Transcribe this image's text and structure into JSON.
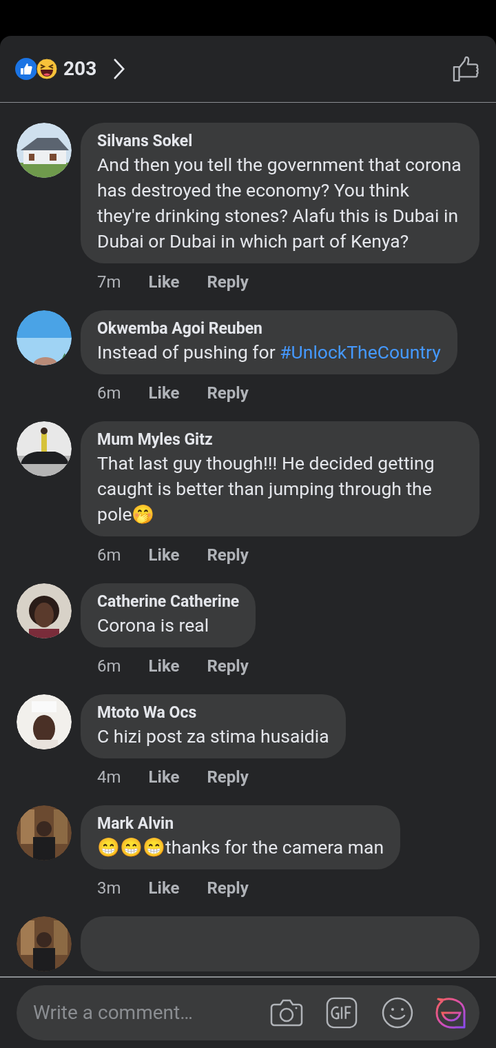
{
  "reactions": {
    "count": "203"
  },
  "comments": [
    {
      "author": "Silvans Sokel",
      "avatar": {
        "kind": "picture"
      },
      "body": [
        {
          "kind": "text",
          "text": "And then you tell the government that corona has destroyed the economy? You think they're drinking stones? Alafu this is Dubai in Dubai or Dubai in which part of Kenya?"
        }
      ],
      "time": "7m",
      "like": "Like",
      "reply": "Reply"
    },
    {
      "author": "Okwemba Agoi Reuben",
      "avatar": {
        "kind": "picture"
      },
      "body": [
        {
          "kind": "text",
          "text": "Instead of pushing for "
        },
        {
          "kind": "hashtag",
          "text": "#UnlockTheCountry"
        }
      ],
      "time": "6m",
      "like": "Like",
      "reply": "Reply"
    },
    {
      "author": "Mum Myles Gitz",
      "avatar": {
        "kind": "picture"
      },
      "body": [
        {
          "kind": "text",
          "text": "That last guy though!!! He decided getting caught is better than jumping through the pole🤭"
        }
      ],
      "time": "6m",
      "like": "Like",
      "reply": "Reply"
    },
    {
      "author": "Catherine Catherine",
      "avatar": {
        "kind": "picture"
      },
      "body": [
        {
          "kind": "text",
          "text": "Corona is real"
        }
      ],
      "time": "6m",
      "like": "Like",
      "reply": "Reply"
    },
    {
      "author": "Mtoto Wa Ocs",
      "avatar": {
        "kind": "picture"
      },
      "body": [
        {
          "kind": "text",
          "text": "C hizi post za stima husaidia"
        }
      ],
      "time": "4m",
      "like": "Like",
      "reply": "Reply"
    },
    {
      "author": "Mark Alvin",
      "avatar": {
        "kind": "picture"
      },
      "body": [
        {
          "kind": "text",
          "text": "😁😁😁thanks for the camera man"
        }
      ],
      "time": "3m",
      "like": "Like",
      "reply": "Reply"
    }
  ],
  "partial_comment": {
    "avatar": {
      "kind": "picture"
    }
  },
  "composer": {
    "placeholder": "Write a comment…"
  }
}
